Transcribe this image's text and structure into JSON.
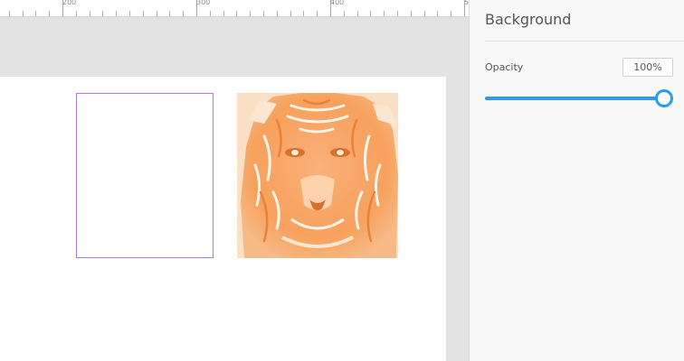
{
  "ruler": {
    "labels": [
      "200",
      "300",
      "400",
      "5"
    ]
  },
  "canvas": {
    "rectangle": "frame-rect",
    "image": "tiger-image",
    "colors": {
      "frame_stroke": "#b07ad6",
      "image_tint": "#f7a15c"
    }
  },
  "panel": {
    "title": "Background",
    "opacity": {
      "label": "Opacity",
      "value": "100%",
      "slider_fraction": 1.0
    },
    "colors": {
      "accent": "#2d9bec"
    }
  }
}
